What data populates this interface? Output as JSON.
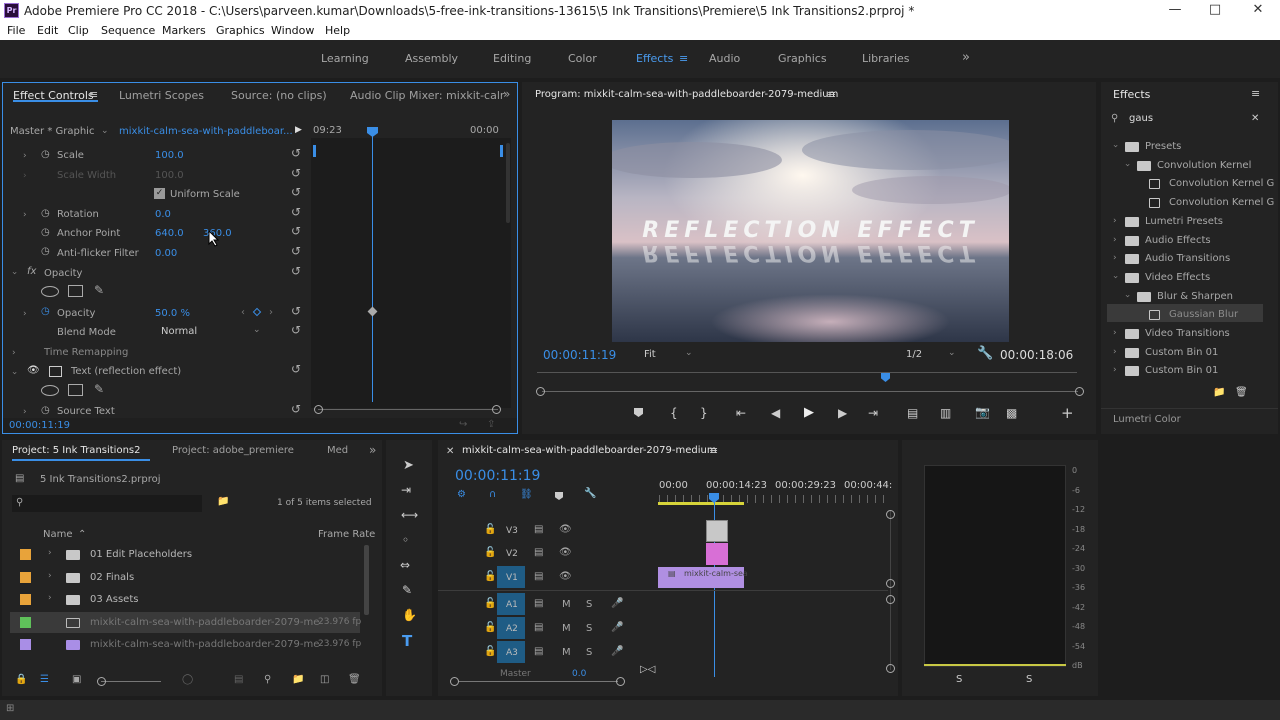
{
  "window": {
    "title": "Adobe Premiere Pro CC 2018 - C:\\Users\\parveen.kumar\\Downloads\\5-free-ink-transitions-13615\\5 Ink Transitions\\Premiere\\5 Ink Transitions2.prproj *",
    "app_icon": "Pr"
  },
  "menu": [
    "File",
    "Edit",
    "Clip",
    "Sequence",
    "Markers",
    "Graphics",
    "Window",
    "Help"
  ],
  "workspaces": {
    "items": [
      "Learning",
      "Assembly",
      "Editing",
      "Color",
      "Effects",
      "Audio",
      "Graphics",
      "Libraries"
    ],
    "active": "Effects",
    "more": "»"
  },
  "effect_controls": {
    "tabs": [
      "Effect Controls",
      "Lumetri Scopes",
      "Source: (no clips)",
      "Audio Clip Mixer: mixkit-calr"
    ],
    "master": "Master * Graphic",
    "clip": "mixkit-calm-sea-with-paddleboar...",
    "time_start": "09:23",
    "time_end": "00:00",
    "scale_label": "Scale",
    "scale_value": "100.0",
    "scale_width_label": "Scale Width",
    "scale_width_value": "100.0",
    "uniform_scale_label": "Uniform Scale",
    "rotation_label": "Rotation",
    "rotation_value": "0.0",
    "anchor_label": "Anchor Point",
    "anchor_x": "640.0",
    "anchor_y": "360.0",
    "antiflicker_label": "Anti-flicker Filter",
    "antiflicker_value": "0.00",
    "opacity_section": "Opacity",
    "opacity_label": "Opacity",
    "opacity_value": "50.0 %",
    "blend_label": "Blend Mode",
    "blend_value": "Normal",
    "time_remap_label": "Time Remapping",
    "text_layer_label": "Text (reflection effect)",
    "source_text_label": "Source Text",
    "timecode": "00:00:11:19"
  },
  "program": {
    "title": "Program: mixkit-calm-sea-with-paddleboarder-2079-medium",
    "overlay_text": "REFLECTION EFFECT",
    "timecode_left": "00:00:11:19",
    "fit": "Fit",
    "resolution": "1/2",
    "timecode_right": "00:00:18:06"
  },
  "effects_panel": {
    "title": "Effects",
    "search": "gaus",
    "tree": [
      {
        "label": "Presets",
        "indent": 0,
        "open": true
      },
      {
        "label": "Convolution Kernel",
        "indent": 1,
        "open": true
      },
      {
        "label": "Convolution Kernel G",
        "indent": 2,
        "open": false
      },
      {
        "label": "Convolution Kernel G",
        "indent": 2,
        "open": false
      },
      {
        "label": "Lumetri Presets",
        "indent": 0,
        "open": false
      },
      {
        "label": "Audio Effects",
        "indent": 0,
        "open": false
      },
      {
        "label": "Audio Transitions",
        "indent": 0,
        "open": false
      },
      {
        "label": "Video Effects",
        "indent": 0,
        "open": true
      },
      {
        "label": "Blur & Sharpen",
        "indent": 1,
        "open": true
      },
      {
        "label": "Gaussian Blur",
        "indent": 2,
        "open": false
      },
      {
        "label": "Video Transitions",
        "indent": 0,
        "open": false
      },
      {
        "label": "Custom Bin 01",
        "indent": 0,
        "open": false
      },
      {
        "label": "Custom Bin 01",
        "indent": 0,
        "open": false
      }
    ],
    "lumetri_color": "Lumetri Color"
  },
  "project": {
    "tabs": [
      "Project: 5 Ink Transitions2",
      "Project: adobe_premiere",
      "Med"
    ],
    "file": "5 Ink Transitions2.prproj",
    "selected_count": "1 of 5 items selected",
    "col_name": "Name",
    "col_rate": "Frame Rate",
    "items": [
      {
        "name": "01 Edit Placeholders",
        "color": "#e8a33a",
        "type": "folder",
        "rate": ""
      },
      {
        "name": "02 Finals",
        "color": "#e8a33a",
        "type": "folder",
        "rate": ""
      },
      {
        "name": "03 Assets",
        "color": "#e8a33a",
        "type": "folder",
        "rate": ""
      },
      {
        "name": "mixkit-calm-sea-with-paddleboarder-2079-me",
        "color": "#5fc15a",
        "type": "seq",
        "rate": "23.976 fp"
      },
      {
        "name": "mixkit-calm-sea-with-paddleboarder-2079-me",
        "color": "#a98ee6",
        "type": "clip",
        "rate": "23.976 fp"
      }
    ]
  },
  "timeline": {
    "title": "mixkit-calm-sea-with-paddleboarder-2079-medium",
    "timecode": "00:00:11:19",
    "ruler": [
      "00:00",
      "00:00:14:23",
      "00:00:29:23",
      "00:00:44:"
    ],
    "video_tracks": [
      "V3",
      "V2",
      "V1"
    ],
    "audio_tracks": [
      "A1",
      "A2",
      "A3"
    ],
    "master": "Master",
    "master_value": "0.0",
    "clip_label": "mixkit-calm-sea"
  },
  "meter": {
    "scale": [
      "0",
      "-6",
      "-12",
      "-18",
      "-24",
      "-30",
      "-36",
      "-42",
      "-48",
      "-54",
      "dB"
    ],
    "solo": [
      "S",
      "S"
    ]
  }
}
